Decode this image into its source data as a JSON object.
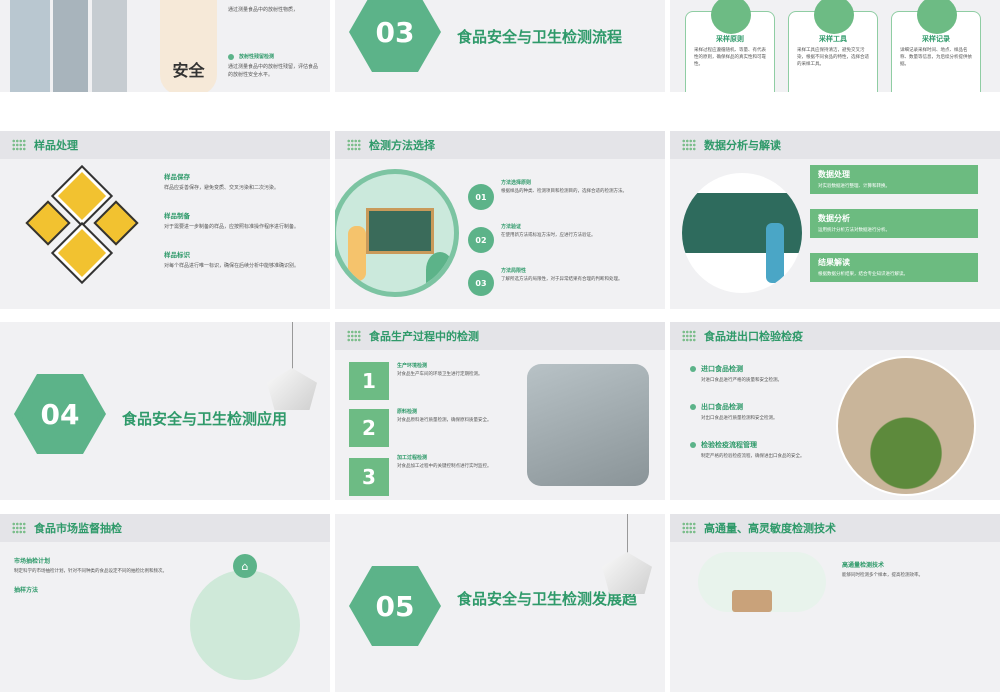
{
  "slides": {
    "s1": {
      "tag": "安全",
      "text1": "通过测量食品中的放射性物质，",
      "label2": "放射性残留检测",
      "text2": "通过测量食品中的放射性残留，评估食品的放射性安全水平。"
    },
    "s2": {
      "number": "03",
      "title": "食品安全与卫生检测流程"
    },
    "s3": {
      "cards": [
        {
          "title": "采样原则",
          "desc": "采样过程应遵循随机、等量、有代表性的原则，确保样品的真实性和可靠性。"
        },
        {
          "title": "采样工具",
          "desc": "采样工具应保持清洁，避免交叉污染，根据不同食品的特性，选择合适的采样工具。"
        },
        {
          "title": "采样记录",
          "desc": "详细记录采样时间、地点、样品名称、数量等信息，为后续分析提供依据。"
        }
      ]
    },
    "s4": {
      "title": "样品处理",
      "items": [
        {
          "label": "样品保存",
          "desc": "样品应妥善保存，避免变质、交叉污染和二次污染。"
        },
        {
          "label": "样品制备",
          "desc": "对于需要进一步制备的样品，应按照标准操作程序进行制备。"
        },
        {
          "label": "样品标识",
          "desc": "对每个样品进行唯一标识，确保在后续分析中能够准确识别。"
        }
      ]
    },
    "s5": {
      "title": "检测方法选择",
      "items": [
        {
          "num": "01",
          "label": "方法选择原则",
          "desc": "根据样品的种类、检测项目和检测目的，选择合适的检测方法。"
        },
        {
          "num": "02",
          "label": "方法验证",
          "desc": "在使用新方法或标准方法时，应进行方法验证。"
        },
        {
          "num": "03",
          "label": "方法局限性",
          "desc": "了解所选方法的局限性，对于异常结果有合理的判断和处理。"
        }
      ]
    },
    "s6": {
      "title": "数据分析与解读",
      "boxes": [
        {
          "title": "数据处理",
          "desc": "对实验数据进行整理、计算和转换。"
        },
        {
          "title": "数据分析",
          "desc": "运用统计分析方法对数据进行分析。"
        },
        {
          "title": "结果解读",
          "desc": "根据数据分析结果，结合专业知识进行解读。"
        }
      ]
    },
    "s7": {
      "number": "04",
      "title": "食品安全与卫生检测应用"
    },
    "s8": {
      "title": "食品生产过程中的检测",
      "items": [
        {
          "num": "1",
          "label": "生产环境检测",
          "desc": "对食品生产车间的环境卫生进行定期检测。"
        },
        {
          "num": "2",
          "label": "原料检测",
          "desc": "对食品原料进行质量检测，确保原料质量安全。"
        },
        {
          "num": "3",
          "label": "加工过程检测",
          "desc": "对食品加工过程中的关键控制点进行实时监控。"
        }
      ]
    },
    "s9": {
      "title": "食品进出口检验检疫",
      "items": [
        {
          "label": "进口食品检测",
          "desc": "对进口食品进行严格的质量和安全检测。"
        },
        {
          "label": "出口食品检测",
          "desc": "对出口食品进行质量检测和安全检测。"
        },
        {
          "label": "检验检疫流程管理",
          "desc": "制定严格的检验检疫流程，确保进出口食品的安全。"
        }
      ]
    },
    "s10": {
      "title": "食品市场监督抽检",
      "label1": "市场抽检计划",
      "desc1": "制定科学的市场抽检计划，针对不同种类的食品设定不同的抽检比例和频次。",
      "label2": "抽样方法"
    },
    "s11": {
      "number": "05",
      "title": "食品安全与卫生检测发展趋"
    },
    "s12": {
      "title": "高通量、高灵敏度检测技术",
      "label1": "高通量检测技术",
      "desc1": "能够同时检测多个样本，提高检测效率。"
    }
  },
  "colors": {
    "accent": "#5cb389",
    "title": "#2f9a6a",
    "bg": "#f1f1f3",
    "header": "#e4e4e8"
  }
}
